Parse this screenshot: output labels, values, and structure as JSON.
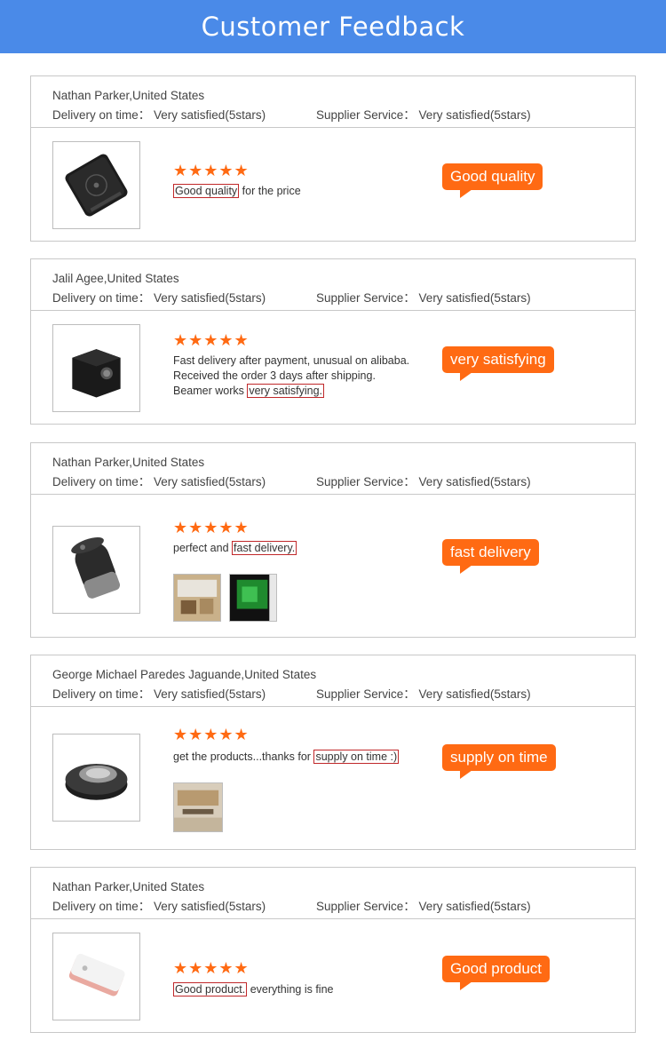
{
  "header": {
    "title": "Customer Feedback"
  },
  "reviews": [
    {
      "name": "Nathan Parker,United States",
      "delivery": "Delivery on time： Very satisfied(5stars)",
      "service": "Supplier Service： Very satisfied(5stars)",
      "stars": "★★★★★",
      "rating": 5,
      "highlight": "Good quality",
      "text_after": " for the price",
      "tag": "Good quality",
      "product_icon": "mini-projector-black-icon"
    },
    {
      "name": "Jalil Agee,United States",
      "delivery": "Delivery on time： Very satisfied(5stars)",
      "service": "Supplier Service： Very satisfied(5stars)",
      "stars": "★★★★★",
      "rating": 5,
      "line1": "Fast delivery after payment, unusual on alibaba.",
      "line2": "Received the order 3 days after shipping.",
      "line3_before": "Beamer works ",
      "highlight": "very satisfying.",
      "tag": "very satisfying",
      "product_icon": "cube-projector-icon"
    },
    {
      "name": "Nathan Parker,United States",
      "delivery": "Delivery on time： Very satisfied(5stars)",
      "service": "Supplier Service： Very satisfied(5stars)",
      "stars": "★★★★★",
      "rating": 5,
      "text_before": "perfect and ",
      "highlight": "fast delivery.",
      "tag": "fast delivery",
      "product_icon": "cylinder-projector-icon"
    },
    {
      "name": "George Michael Paredes Jaguande,United States",
      "delivery": "Delivery on time： Very satisfied(5stars)",
      "service": "Supplier Service： Very satisfied(5stars)",
      "stars": "★★★★★",
      "rating": 5,
      "text_before": "get the products...thanks for ",
      "highlight": "supply on time :)",
      "tag": "supply on time",
      "product_icon": "round-projector-icon"
    },
    {
      "name": "Nathan Parker,United States",
      "delivery": "Delivery on time： Very satisfied(5stars)",
      "service": "Supplier Service： Very satisfied(5stars)",
      "stars": "★★★★★",
      "rating": 5,
      "highlight": "Good product.",
      "text_after": " everything is fine",
      "tag": "Good product",
      "product_icon": "pink-projector-icon"
    }
  ],
  "colors": {
    "banner": "#4a8ae8",
    "accent": "#ff6a13",
    "highlight_border": "#c0282a"
  }
}
